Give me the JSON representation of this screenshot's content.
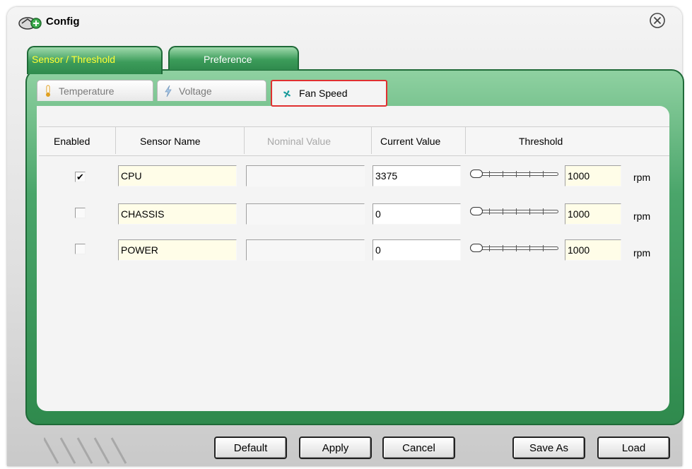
{
  "window": {
    "title": "Config",
    "title_icon": "monitor-gear-icon",
    "close_icon": "close-circle-icon"
  },
  "main_tabs": [
    {
      "label": "Sensor / Threshold",
      "active": true
    },
    {
      "label": "Preference",
      "active": false
    }
  ],
  "sub_tabs": [
    {
      "label": "Temperature",
      "icon": "thermometer-icon",
      "active": false
    },
    {
      "label": "Voltage",
      "icon": "lightning-icon",
      "active": false
    },
    {
      "label": "Fan Speed",
      "icon": "fan-icon",
      "active": true
    }
  ],
  "table": {
    "headers": {
      "enabled": "Enabled",
      "sensor_name": "Sensor Name",
      "nominal_value": "Nominal Value",
      "current_value": "Current Value",
      "threshold": "Threshold"
    },
    "rows": [
      {
        "enabled": true,
        "enabled_mark": "✔",
        "sensor_name": "CPU",
        "nominal_value": "",
        "current_value": "3375",
        "threshold_slider_position": 0,
        "threshold": "1000",
        "unit": "rpm"
      },
      {
        "enabled": false,
        "enabled_mark": "",
        "sensor_name": "CHASSIS",
        "nominal_value": "",
        "current_value": "0",
        "threshold_slider_position": 0,
        "threshold": "1000",
        "unit": "rpm"
      },
      {
        "enabled": false,
        "enabled_mark": "",
        "sensor_name": "POWER",
        "nominal_value": "",
        "current_value": "0",
        "threshold_slider_position": 0,
        "threshold": "1000",
        "unit": "rpm"
      }
    ]
  },
  "buttons": {
    "default": "Default",
    "apply": "Apply",
    "cancel": "Cancel",
    "save_as": "Save As",
    "load": "Load"
  },
  "colors": {
    "frame_green": "#3c9c5a",
    "active_tab_text": "#ffff33",
    "highlight_border": "#e03030",
    "name_field_bg": "#fffde8"
  }
}
